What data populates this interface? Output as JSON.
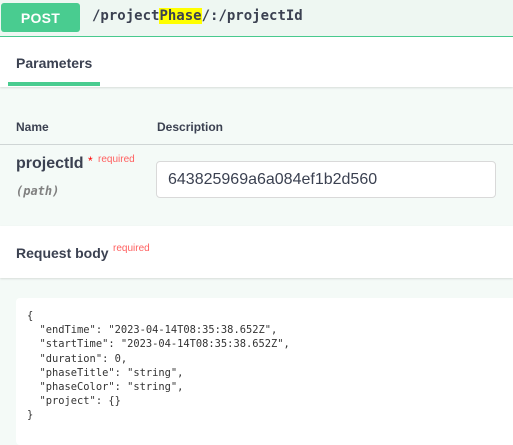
{
  "summary": {
    "method": "POST",
    "path_prefix": "/project",
    "path_highlight": "Phase",
    "path_suffix": "/:/projectId"
  },
  "parameters": {
    "tab_label": "Parameters",
    "col_name": "Name",
    "col_description": "Description",
    "param": {
      "name": "projectId",
      "star": "*",
      "required": "required",
      "in": "(path)",
      "value": "643825969a6a084ef1b2d560"
    }
  },
  "request_body": {
    "title": "Request body",
    "required": "required",
    "json": "{\n  \"endTime\": \"2023-04-14T08:35:38.652Z\",\n  \"startTime\": \"2023-04-14T08:35:38.652Z\",\n  \"duration\": 0,\n  \"phaseTitle\": \"string\",\n  \"phaseColor\": \"string\",\n  \"project\": {}\n}"
  },
  "colors": {
    "accent": "#49cc90",
    "highlight": "#ffff00",
    "required": "#ff6060"
  }
}
